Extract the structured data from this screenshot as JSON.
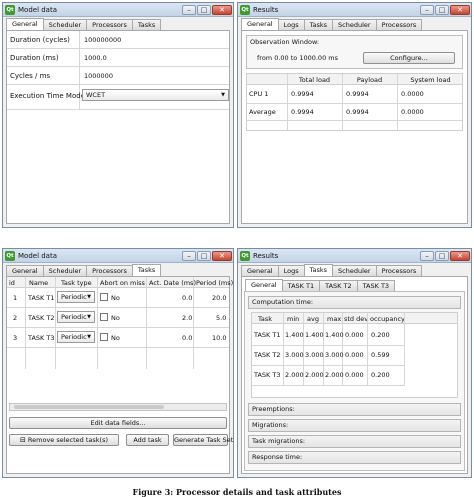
{
  "caption": "Figure 3: Processor details and task attributes",
  "model_top": {
    "title": "Model data",
    "tabs": [
      "General",
      "Scheduler",
      "Processors",
      "Tasks"
    ],
    "fields": [
      {
        "label": "Duration (cycles)",
        "value": "100000000"
      },
      {
        "label": "Duration (ms)",
        "value": "1000.0"
      },
      {
        "label": "Cycles / ms",
        "value": "1000000"
      }
    ],
    "exec_label": "Execution Time Model",
    "exec_value": "WCET"
  },
  "results_top": {
    "title": "Results",
    "tabs": [
      "General",
      "Logs",
      "Tasks",
      "Scheduler",
      "Processors"
    ],
    "obs_label": "Observation Window:",
    "obs_range": "from 0.00 to 1000.00 ms",
    "configure": "Configure...",
    "headers": [
      "Total load",
      "Payload",
      "System load"
    ],
    "rows": [
      {
        "name": "CPU 1",
        "values": [
          "0.9994",
          "0.9994",
          "0.0000"
        ]
      },
      {
        "name": "Average",
        "values": [
          "0.9994",
          "0.9994",
          "0.0000"
        ]
      }
    ]
  },
  "model_bottom": {
    "title": "Model data",
    "tabs": [
      "General",
      "Scheduler",
      "Processors",
      "Tasks"
    ],
    "headers": [
      "id",
      "Name",
      "Task type",
      "Abort on miss",
      "Act. Date (ms)",
      "Period (ms)"
    ],
    "rows": [
      {
        "id": "1",
        "name": "TASK T1",
        "type": "Periodic",
        "abort": "No",
        "act": "0.0",
        "period": "20.0"
      },
      {
        "id": "2",
        "name": "TASK T2",
        "type": "Periodic",
        "abort": "No",
        "act": "2.0",
        "period": "5.0"
      },
      {
        "id": "3",
        "name": "TASK T3",
        "type": "Periodic",
        "abort": "No",
        "act": "0.0",
        "period": "10.0"
      }
    ],
    "edit_fields": "Edit data fields...",
    "remove": "Remove selected task(s)",
    "add": "Add task",
    "generate": "Generate Task Set"
  },
  "results_bottom": {
    "title": "Results",
    "tabs": [
      "General",
      "Logs",
      "Tasks",
      "Scheduler",
      "Processors"
    ],
    "subtabs": [
      "General",
      "TASK T1",
      "TASK T2",
      "TASK T3"
    ],
    "computation": "Computation time:",
    "headers": [
      "Task",
      "min",
      "avg",
      "max",
      "std dev",
      "occupancy"
    ],
    "rows": [
      {
        "task": "TASK T1",
        "min": "1.400",
        "avg": "1.400",
        "max": "1.400",
        "std": "0.000",
        "occ": "0.200"
      },
      {
        "task": "TASK T2",
        "min": "3.000",
        "avg": "3.000",
        "max": "3.000",
        "std": "0.000",
        "occ": "0.599"
      },
      {
        "task": "TASK T3",
        "min": "2.000",
        "avg": "2.000",
        "max": "2.000",
        "std": "0.000",
        "occ": "0.200"
      }
    ],
    "sections": [
      "Preemptions:",
      "Migrations:",
      "Task migrations:",
      "Response time:"
    ]
  }
}
